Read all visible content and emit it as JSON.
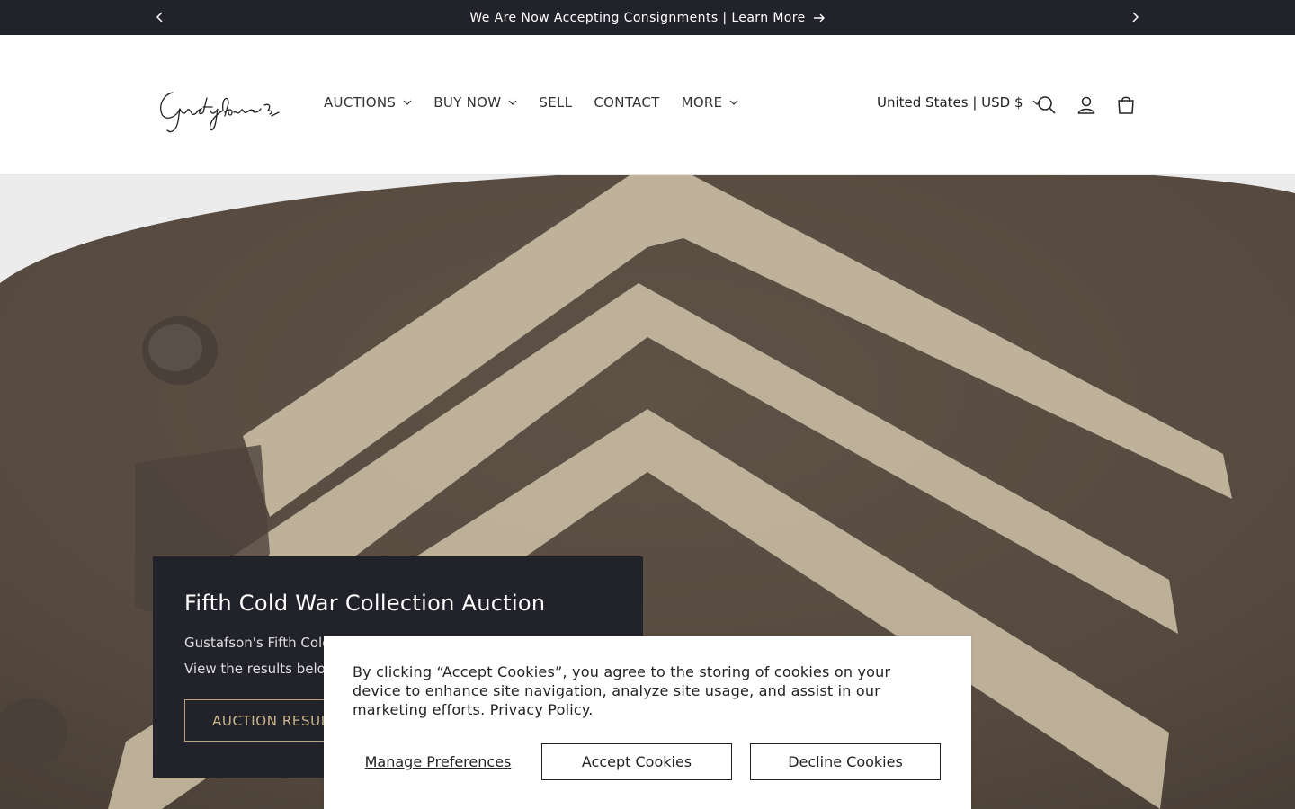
{
  "announcement": {
    "message": "We Are Now Accepting Consignments | Learn More"
  },
  "header": {
    "logo_text": "Gustafson's",
    "nav": [
      {
        "label": "AUCTIONS",
        "has_dropdown": true
      },
      {
        "label": "BUY NOW",
        "has_dropdown": true
      },
      {
        "label": "SELL",
        "has_dropdown": false
      },
      {
        "label": "CONTACT",
        "has_dropdown": false
      },
      {
        "label": "MORE",
        "has_dropdown": true
      }
    ],
    "locale": "United States | USD $"
  },
  "hero": {
    "title": "Fifth Cold War Collection Auction",
    "line1": "Gustafson's Fifth Cold War Collection Auction has concluded.",
    "line2": "View the results below.",
    "button_label": "AUCTION RESULTS"
  },
  "cookie": {
    "text": "By clicking “Accept Cookies”, you agree to the storing of cookies on your device to enhance site navigation, analyze site usage, and assist in our marketing efforts.",
    "privacy_link": "Privacy Policy.",
    "manage_label": "Manage Preferences",
    "accept_label": "Accept Cookies",
    "decline_label": "Decline Cookies"
  },
  "colors": {
    "dark": "#22232a",
    "gold": "#c9b48c",
    "helmet": "#5b4f44",
    "chevron": "#c8bba3"
  }
}
